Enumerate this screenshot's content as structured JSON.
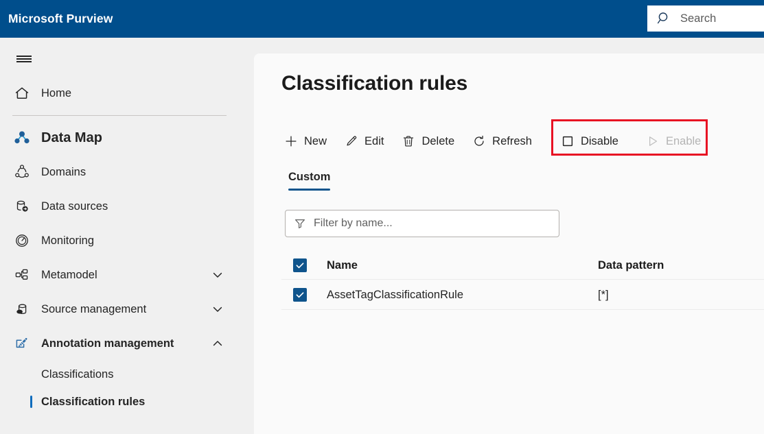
{
  "colors": {
    "header_blue": "#004e8c",
    "accent_blue": "#0f6cbd",
    "tab_accent": "#0f548c",
    "highlight_red": "#e81123",
    "checkbox_blue": "#0f548c"
  },
  "header": {
    "brand": "Microsoft Purview",
    "search": {
      "placeholder": "Search",
      "value": "",
      "icon": "search-icon"
    },
    "hamburger_icon": "hamburger-menu-icon"
  },
  "sidebar": {
    "home": {
      "label": "Home",
      "icon": "home-icon"
    },
    "section": {
      "label": "Data Map",
      "icon": "data-map-icon"
    },
    "items": [
      {
        "label": "Domains",
        "icon": "domains-icon",
        "expandable": false
      },
      {
        "label": "Data sources",
        "icon": "data-sources-icon",
        "expandable": false
      },
      {
        "label": "Monitoring",
        "icon": "monitoring-icon",
        "expandable": false
      },
      {
        "label": "Metamodel",
        "icon": "metamodel-icon",
        "expandable": true,
        "expanded": false,
        "chevron": "chevron-down-icon"
      },
      {
        "label": "Source management",
        "icon": "source-management-icon",
        "expandable": true,
        "expanded": false,
        "chevron": "chevron-down-icon"
      },
      {
        "label": "Annotation management",
        "icon": "annotation-management-icon",
        "expandable": true,
        "expanded": true,
        "chevron": "chevron-up-icon"
      }
    ],
    "subitems": [
      {
        "label": "Classifications",
        "active": false
      },
      {
        "label": "Classification rules",
        "active": true
      }
    ]
  },
  "main": {
    "title": "Classification rules",
    "toolbar": [
      {
        "label": "New",
        "icon": "add-icon",
        "disabled": false
      },
      {
        "label": "Edit",
        "icon": "pencil-icon",
        "disabled": false
      },
      {
        "label": "Delete",
        "icon": "trash-icon",
        "disabled": false
      },
      {
        "label": "Refresh",
        "icon": "refresh-icon",
        "disabled": false
      },
      {
        "label": "Disable",
        "icon": "stop-square-icon",
        "disabled": false
      },
      {
        "label": "Enable",
        "icon": "play-triangle-icon",
        "disabled": true
      }
    ],
    "tabs": [
      {
        "label": "Custom",
        "active": true
      }
    ],
    "filter": {
      "placeholder": "Filter by name...",
      "value": "",
      "icon": "filter-icon"
    },
    "table": {
      "select_all_checked": true,
      "columns": [
        {
          "key": "name",
          "label": "Name"
        },
        {
          "key": "pattern",
          "label": "Data pattern"
        }
      ],
      "rows": [
        {
          "checked": true,
          "name": "AssetTagClassificationRule",
          "pattern": "[*]"
        }
      ]
    }
  }
}
